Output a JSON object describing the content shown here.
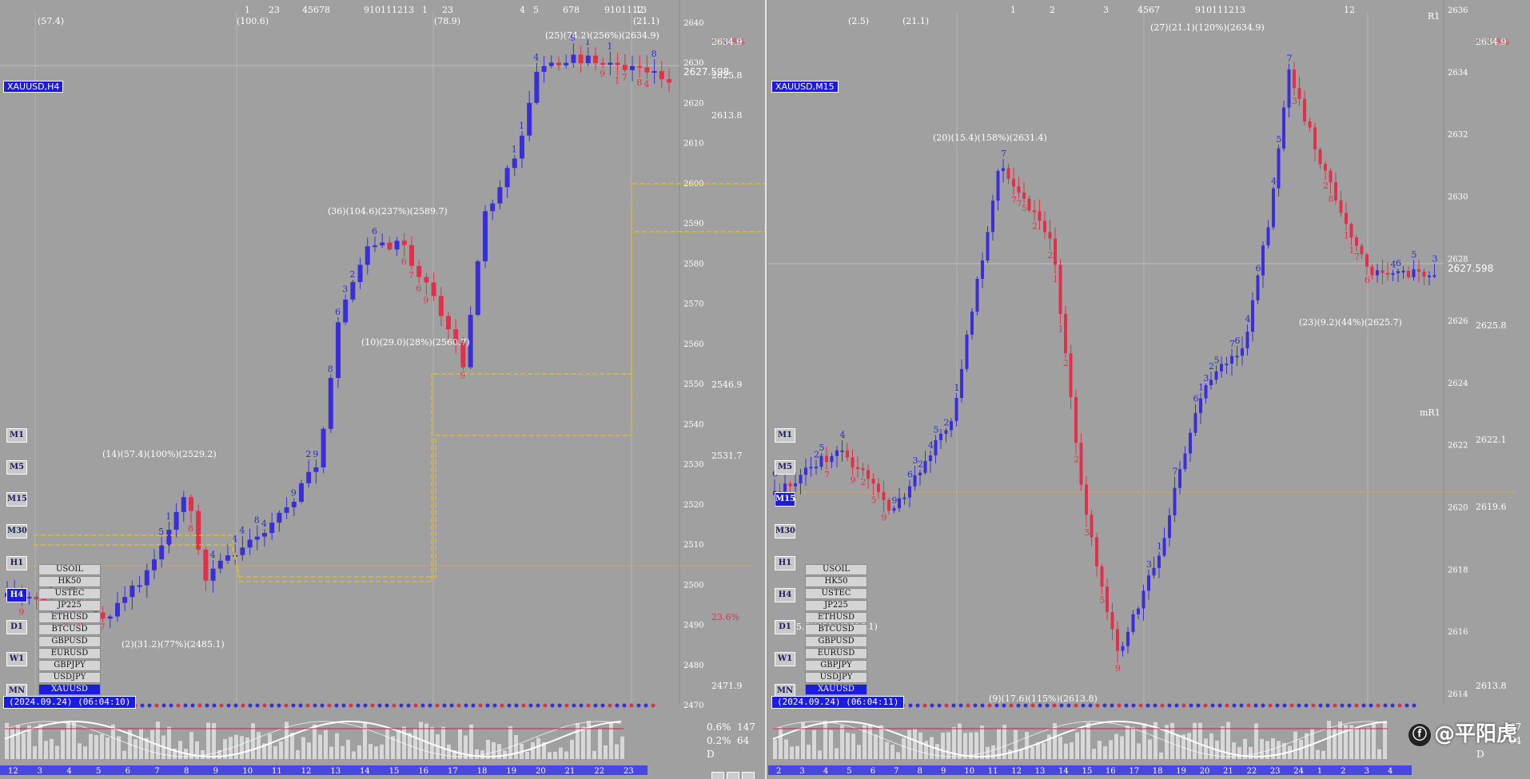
{
  "left": {
    "symbol": "XAUUSD,H4",
    "datetime": "(2024.09.24) (06:04:10)",
    "prices": [
      "2640",
      "2630",
      "2620",
      "2610",
      "2600",
      "2590",
      "2580",
      "2570",
      "2560",
      "2550",
      "2540",
      "2530",
      "2520",
      "2510",
      "2500",
      "2490",
      "2480",
      "2470"
    ],
    "price_current": "2627.598",
    "side_values": [
      "161.8%",
      "2634.9",
      "2625.8",
      "2613.8",
      "2546.9",
      "2531.7",
      "23.6%",
      "2471.9"
    ],
    "swing_labels": [
      "(25)(74.2)(256%)(2634.9)",
      "(36)(104.6)(237%)(2589.7)",
      "(10)(29.0)(28%)(2560.7)",
      "(14)(57.4)(100%)(2529.2)",
      "(2)(31.2)(77%)(2485.1)"
    ],
    "top_labels": [
      "(57.4)",
      "(100.6)",
      "(78.9)",
      "(21.1)"
    ],
    "top_counts": [
      "1",
      "23",
      "45678",
      "910111213",
      "1",
      "23",
      "4",
      "5",
      "678",
      "9101112",
      "13"
    ],
    "timeframes": [
      "M1",
      "M5",
      "M15",
      "M30",
      "H1",
      "H4",
      "D1",
      "W1",
      "MN"
    ],
    "active_tf": "H4",
    "symbols": [
      "USOIL",
      "HK50",
      "USTEC",
      "JP225",
      "ETHUSD",
      "BTCUSD",
      "GBPUSD",
      "EURUSD",
      "GBPJPY",
      "USDJPY",
      "XAUUSD"
    ],
    "active_symbol": "XAUUSD",
    "bottom_axis": [
      "12",
      "3",
      "4",
      "5",
      "6",
      "7",
      "8",
      "9",
      "10",
      "11",
      "12",
      "13",
      "14",
      "15",
      "16",
      "17",
      "18",
      "19",
      "20",
      "21",
      "22",
      "23"
    ],
    "pct_a": "0.6%",
    "pct_a_val": "147",
    "pct_b": "0.2%",
    "pct_b_val": "64",
    "period": "D"
  },
  "right": {
    "symbol": "XAUUSD,M15",
    "datetime": "(2024.09.24) (06:04:11)",
    "prices": [
      "2636",
      "2634",
      "2632",
      "2630",
      "2628",
      "2626",
      "2624",
      "2622",
      "2620",
      "2618",
      "2616",
      "2614"
    ],
    "price_current": "2627.598",
    "side_values": [
      "161.8%",
      "2634.9",
      "2625.8",
      "2622.1",
      "2619.6",
      "2613.8"
    ],
    "mr1": "mR1",
    "r1": "R1",
    "swing_labels": [
      "(27)(21.1)(120%)(2634.9)",
      "(20)(15.4)(158%)(2631.4)",
      "(23)(9.2)(44%)(2625.7)",
      "(11)(5.6)(42%)(2616.1)",
      "(9)(17.6)(115%)(2613.8)"
    ],
    "top_labels": [
      "(2.5)",
      "(21.1)"
    ],
    "top_counts": [
      "1",
      "2",
      "3",
      "4567",
      "910111213",
      "12"
    ],
    "timeframes": [
      "M1",
      "M5",
      "M15",
      "M30",
      "H1",
      "H4",
      "D1",
      "W1",
      "MN"
    ],
    "active_tf": "M15",
    "symbols": [
      "USOIL",
      "HK50",
      "USTEC",
      "JP225",
      "ETHUSD",
      "BTCUSD",
      "GBPUSD",
      "EURUSD",
      "GBPJPY",
      "USDJPY",
      "XAUUSD"
    ],
    "active_symbol": "XAUUSD",
    "bottom_axis": [
      "2",
      "3",
      "4",
      "5",
      "6",
      "7",
      "8",
      "9",
      "10",
      "11",
      "12",
      "13",
      "14",
      "15",
      "16",
      "17",
      "18",
      "19",
      "20",
      "21",
      "22",
      "23",
      "24",
      "1",
      "2",
      "3",
      "4"
    ],
    "pct_a": "47",
    "pct_b": "64",
    "period": "D"
  },
  "watermark": "@平阳虎",
  "colors": {
    "bull": "#3a2fd6",
    "bear": "#e0304a",
    "fib": "#e8c020",
    "bg": "#a0a0a0"
  }
}
